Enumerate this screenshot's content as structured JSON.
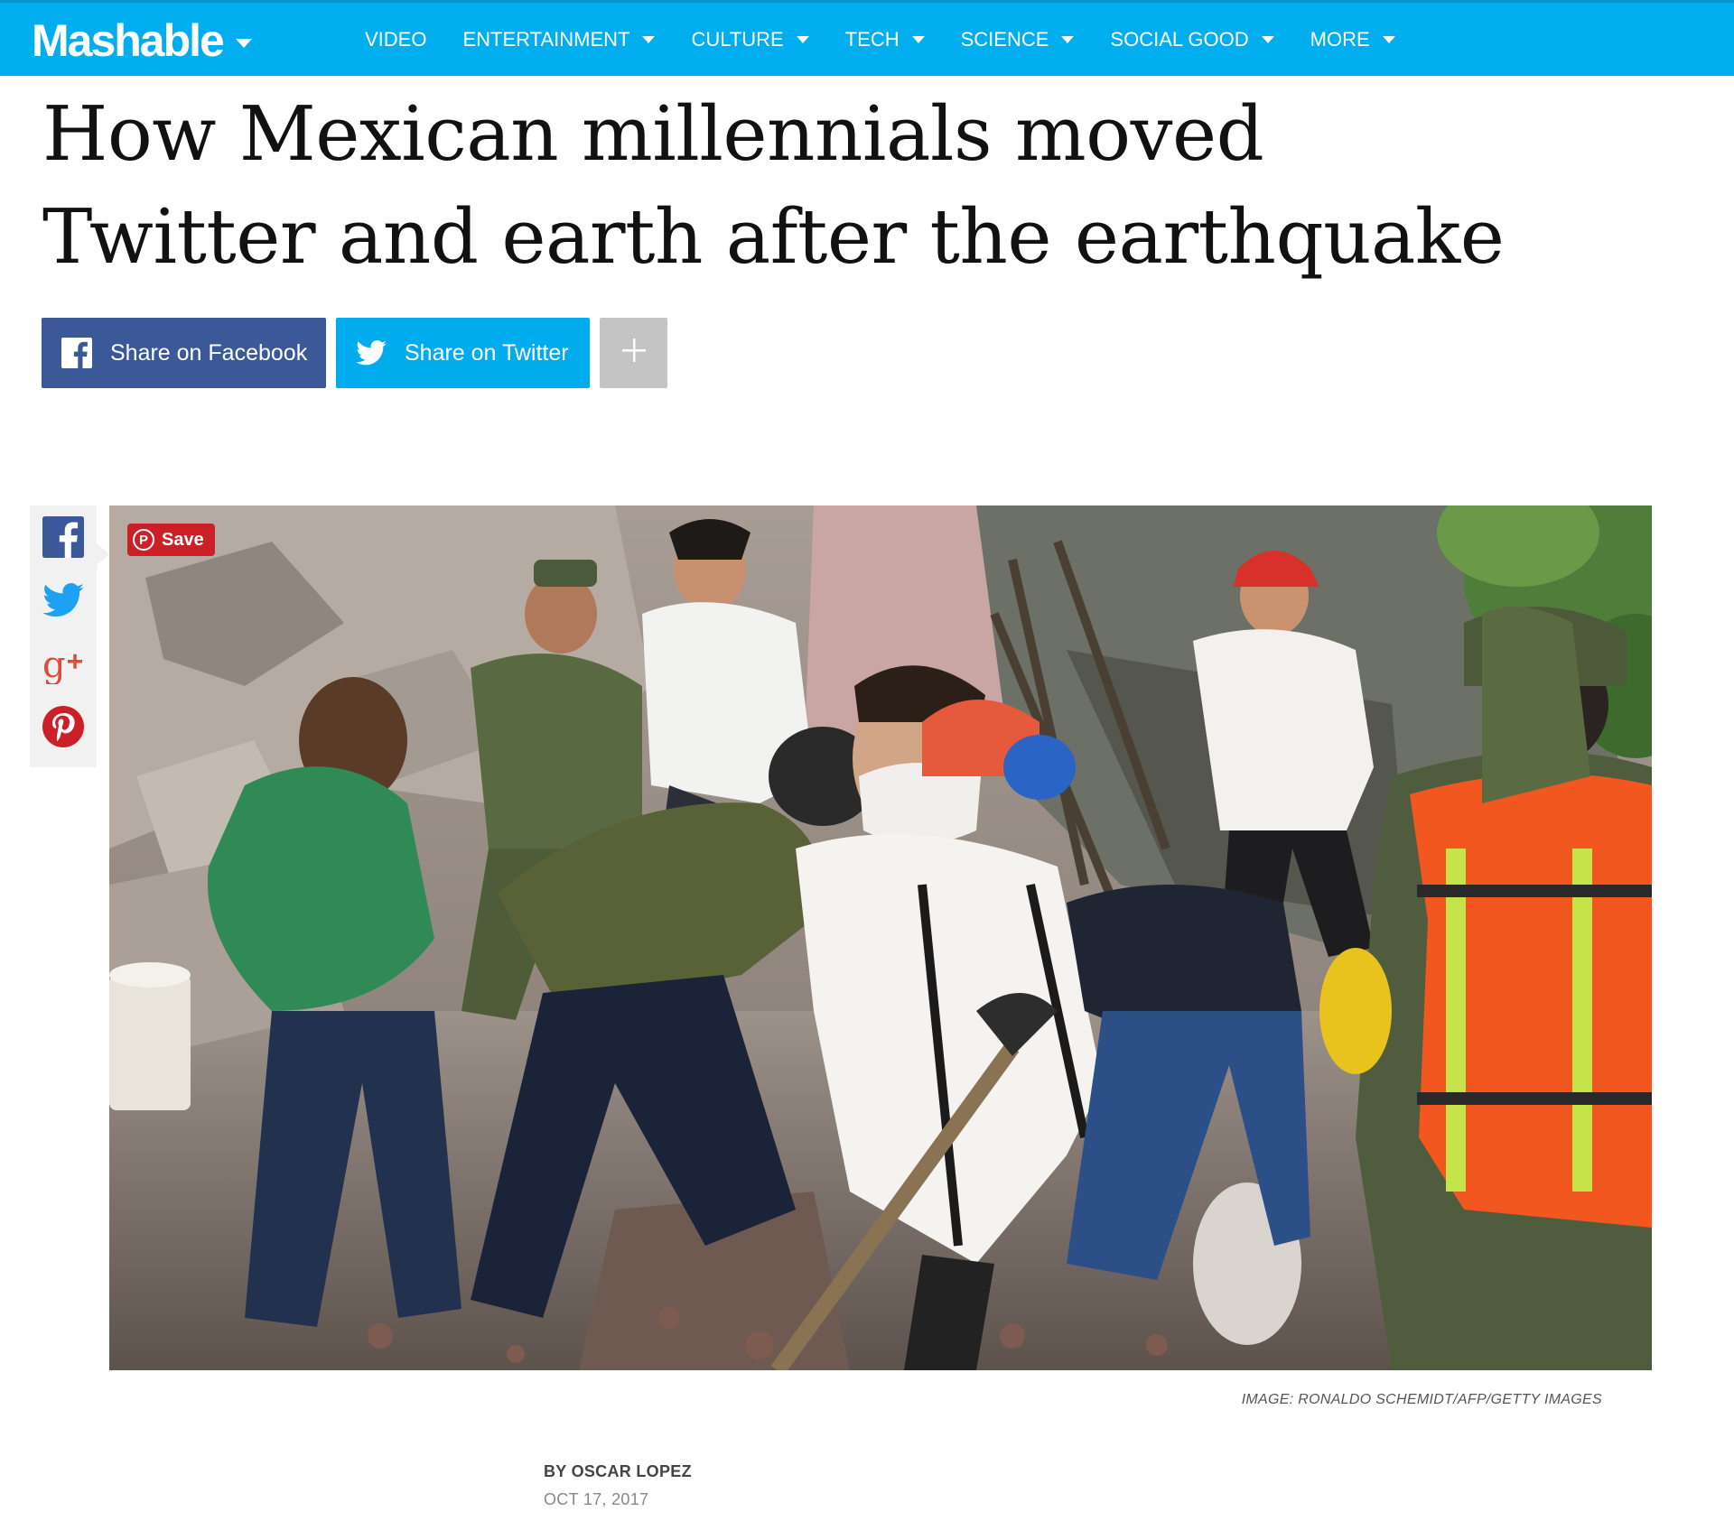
{
  "nav": {
    "logo": "Mashable",
    "items": [
      {
        "label": "VIDEO",
        "has_caret": false
      },
      {
        "label": "ENTERTAINMENT",
        "has_caret": true
      },
      {
        "label": "CULTURE",
        "has_caret": true
      },
      {
        "label": "TECH",
        "has_caret": true
      },
      {
        "label": "SCIENCE",
        "has_caret": true
      },
      {
        "label": "SOCIAL GOOD",
        "has_caret": true
      },
      {
        "label": "MORE",
        "has_caret": true
      }
    ],
    "colors": {
      "bar": "#00aeef",
      "text": "#ffffff"
    }
  },
  "article": {
    "headline_line1": "How Mexican millennials moved",
    "headline_line2": "Twitter and earth after the earthquake",
    "image_caption": "IMAGE: RONALDO SCHEMIDT/AFP/GETTY IMAGES",
    "byline": "BY OSCAR LOPEZ",
    "date": "OCT 17, 2017"
  },
  "share": {
    "facebook_label": "Share on Facebook",
    "twitter_label": "Share on Twitter",
    "more_icon": "plus-icon",
    "colors": {
      "facebook": "#3b5998",
      "twitter": "#00aced",
      "more": "#c4c4c4"
    }
  },
  "side_share": {
    "icons": [
      "facebook-icon",
      "twitter-icon",
      "google-plus-icon",
      "pinterest-icon"
    ]
  },
  "image_overlay": {
    "pin_save_label": "Save"
  }
}
